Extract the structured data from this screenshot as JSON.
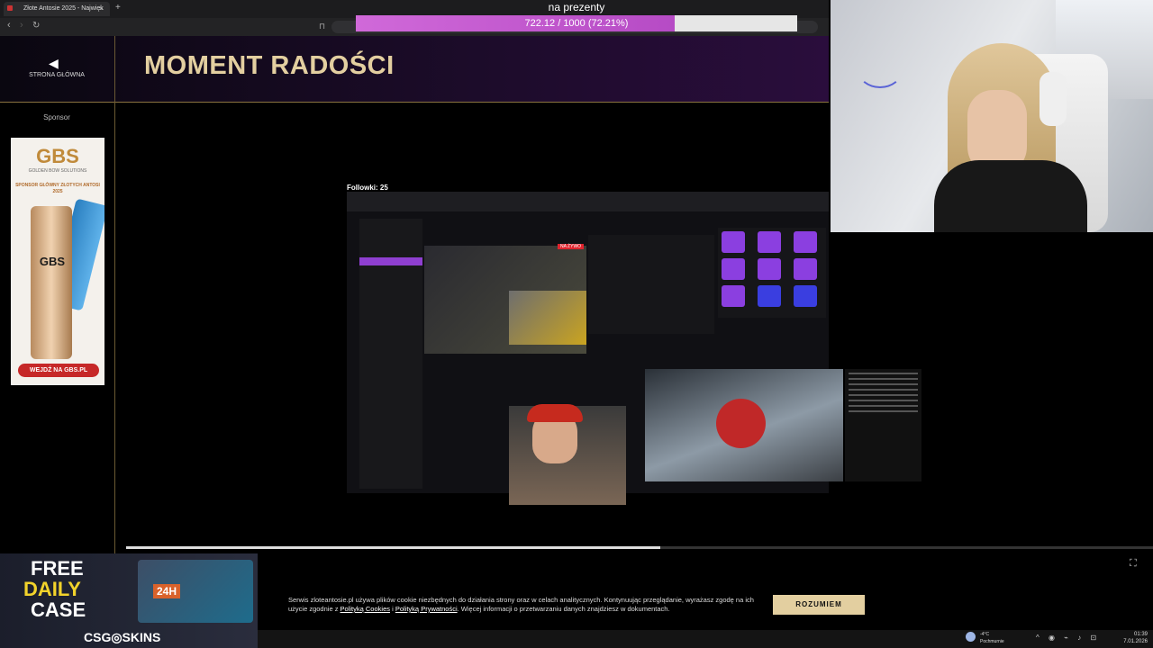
{
  "browser": {
    "tab_title": "Złote Antosie 2025 - Najwięk",
    "close": "×",
    "new_tab": "+",
    "back": "‹",
    "forward": "›",
    "reload": "↻",
    "bookmark": "⊓"
  },
  "overlay": {
    "goal_title": "na prezenty",
    "goal_text": "722.12 / 1000 (72.21%)",
    "goal_progress": 0.7221
  },
  "site": {
    "home_label": "STRONA GŁÓWNA",
    "home_arrow": "◀",
    "page_title": "MOMENT RADOŚCI",
    "sponsor_label": "Sponsor",
    "ad": {
      "logo": "GBS",
      "subtitle": "GOLDEN BOW SOLUTIONS",
      "tagline": "SPONSOR GŁÓWNY ZŁOTYCH ANTOSI 2025",
      "can_text": "GBS",
      "cta": "WEJDŹ NA GBS.PL"
    }
  },
  "video": {
    "follows": "Followki: 25",
    "live_badge": "NA ŻYWO",
    "progress": 0.52,
    "fullscreen_icon": "⛶"
  },
  "csgo_ad": {
    "line1": "FREE",
    "line2": "DAILY",
    "line3": "CASE",
    "box_tag": "24H",
    "brand": "CSG◎SKINS"
  },
  "cookie": {
    "text_before": "Serwis zloteantosie.pl używa plików cookie niezbędnych do działania strony oraz w celach analitycznych. Kontynuując przeglądanie, wyrażasz zgodę na ich użycie zgodnie z ",
    "link1": "Polityką Cookies",
    "text_mid": " i ",
    "link2": "Polityką Prywatności",
    "text_after": ". Więcej informacji o przetwarzaniu danych znajdziesz w dokumentach.",
    "button": "ROZUMIEM"
  },
  "taskbar": {
    "weather_temp": "-4°C",
    "weather_desc": "Pochmurnie",
    "time": "01:39",
    "date": "7.01.2026"
  }
}
